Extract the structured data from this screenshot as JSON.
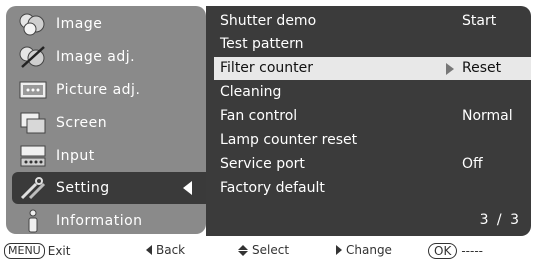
{
  "left_menu": {
    "items": [
      {
        "label": "Image",
        "icon": "image-icon"
      },
      {
        "label": "Image adj.",
        "icon": "image-adj-icon"
      },
      {
        "label": "Picture adj.",
        "icon": "picture-adj-icon"
      },
      {
        "label": "Screen",
        "icon": "screen-icon"
      },
      {
        "label": "Input",
        "icon": "input-icon"
      },
      {
        "label": "Setting",
        "icon": "setting-icon"
      },
      {
        "label": "Information",
        "icon": "information-icon"
      }
    ],
    "selected_index": 5
  },
  "settings": {
    "rows": [
      {
        "label": "Shutter demo",
        "value": "Start"
      },
      {
        "label": "Test pattern",
        "value": ""
      },
      {
        "label": "Filter counter",
        "value": "Reset"
      },
      {
        "label": "Cleaning",
        "value": ""
      },
      {
        "label": "Fan  control",
        "value": "Normal"
      },
      {
        "label": "Lamp counter reset",
        "value": ""
      },
      {
        "label": "Service port",
        "value": "Off"
      },
      {
        "label": "Factory  default",
        "value": ""
      }
    ],
    "highlighted_index": 2,
    "page": "3 / 3"
  },
  "help_bar": {
    "menu_key": "MENU",
    "exit": "Exit",
    "back": "Back",
    "select": "Select",
    "change": "Change",
    "ok_key": "OK",
    "ok_action": "-----"
  },
  "colors": {
    "left_panel": "#8a8a8a",
    "right_panel": "#3b3b3b",
    "selected_menu": "#3a3a3a",
    "highlight_row": "#e8e8e8"
  }
}
